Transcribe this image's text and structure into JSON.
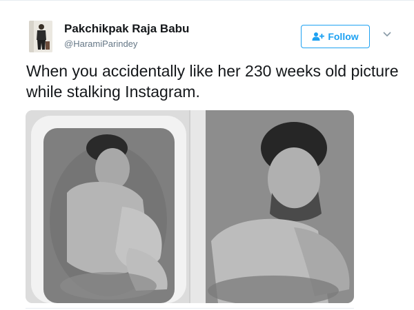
{
  "user": {
    "display_name": "Pakchikpak Raja Babu",
    "handle": "@HaramiParindey",
    "avatar_icon": "profile-photo"
  },
  "actions": {
    "follow_label": "Follow",
    "follow_icon": "add-user-icon",
    "menu_icon": "chevron-down-icon"
  },
  "tweet": {
    "text": "When you accidentally like her 230 weeks old picture while stalking Instagram."
  },
  "media": {
    "photo_count": 2
  },
  "colors": {
    "accent": "#1da1f2",
    "text": "#14171a",
    "secondary": "#657786"
  }
}
